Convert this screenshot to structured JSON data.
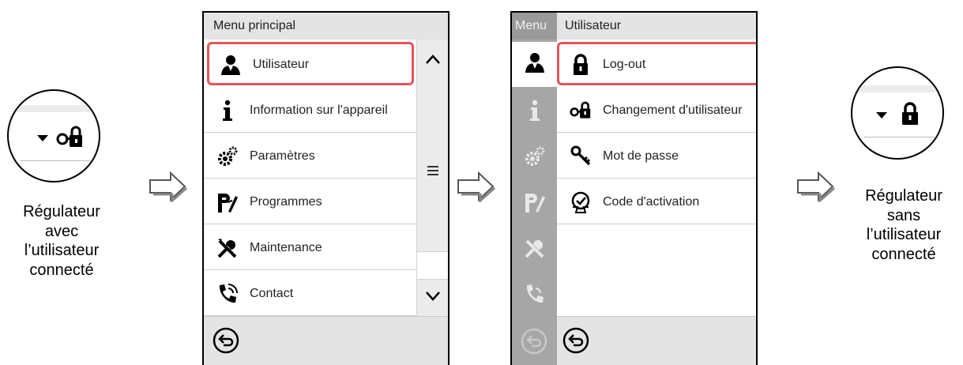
{
  "zoom_left": {
    "caption_lines": [
      "Régulateur",
      "avec",
      "l’utilisateur",
      "connecté"
    ],
    "lock_icon": "user-lock-icon",
    "dropdown_icon": "dropdown-triangle-icon"
  },
  "zoom_right": {
    "caption_lines": [
      "Régulateur",
      "sans",
      "l’utilisateur",
      "connecté"
    ],
    "lock_icon": "lock-icon",
    "dropdown_icon": "dropdown-triangle-icon"
  },
  "screen1": {
    "header": "Menu principal",
    "items": [
      {
        "label": "Utilisateur",
        "icon": "user-icon",
        "selected": true
      },
      {
        "label": "Information sur l'appareil",
        "icon": "info-icon"
      },
      {
        "label": "Paramètres",
        "icon": "gears-icon"
      },
      {
        "label": "Programmes",
        "icon": "programs-icon"
      },
      {
        "label": "Maintenance",
        "icon": "tools-icon"
      },
      {
        "label": "Contact",
        "icon": "phone-icon"
      }
    ],
    "scrollbar_icons": [
      "chevron-up-icon",
      "menu-lines-icon",
      "chevron-down-icon"
    ],
    "back_icon": "back-arrow-icon"
  },
  "screen2": {
    "rail_label": "Menu",
    "header": "Utilisateur",
    "items": [
      {
        "label": "Log-out",
        "icon": "lock-icon",
        "selected": true
      },
      {
        "label": "Changement d'utilisateur",
        "icon": "user-lock-icon"
      },
      {
        "label": "Mot de passe",
        "icon": "key-icon"
      },
      {
        "label": "Code d'activation",
        "icon": "activation-code-icon"
      }
    ],
    "back_icon": "back-arrow-icon"
  },
  "colors": {
    "highlight": "#e5545a",
    "panel_gray": "#e4e4e4",
    "rail_gray": "#a6a6a6"
  }
}
